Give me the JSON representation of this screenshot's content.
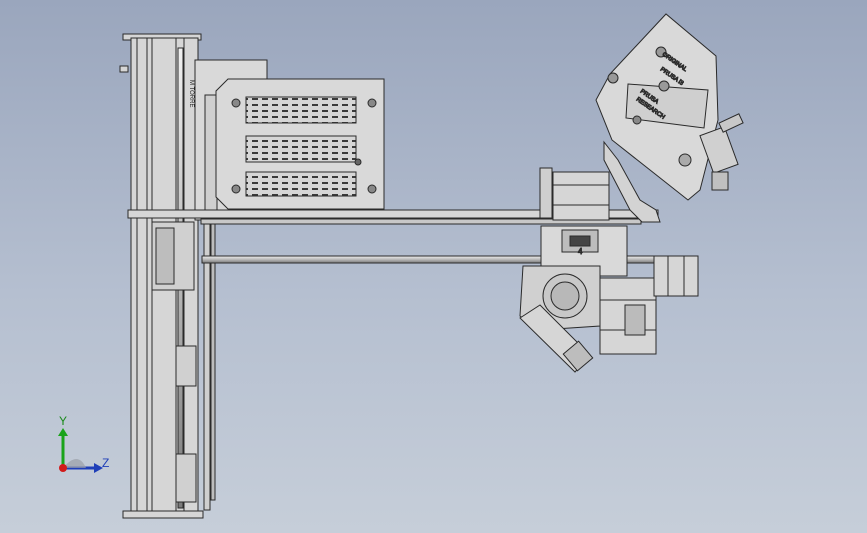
{
  "window": {
    "title": "",
    "background_top": "#9aa6bd",
    "background_bottom": "#c6ced9"
  },
  "triad": {
    "y_label": "Y",
    "z_label": "Z",
    "y_color": "#1aa31a",
    "z_color": "#1f3fb8",
    "x_color": "#d11a1a"
  },
  "model": {
    "part_color": "#d6d6d6",
    "edge_color": "#2a2a2a",
    "rail_label": "M TORRE",
    "extruder_label_1": "ORIGINAL",
    "extruder_label_2": "PRUSA i3",
    "extruder_label_3": "PRUSA",
    "extruder_label_4": "RESEARCH",
    "motor_label": "4"
  }
}
